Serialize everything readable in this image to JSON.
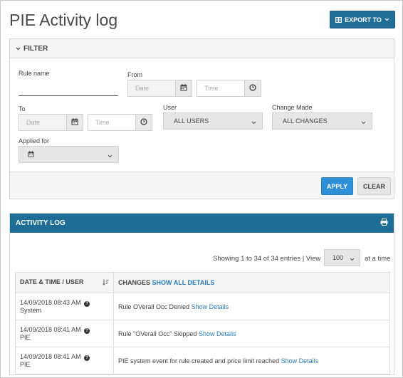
{
  "page": {
    "title": "PIE Activity log"
  },
  "export": {
    "label": "EXPORT TO",
    "icon": "table-icon"
  },
  "filter": {
    "header": "FILTER",
    "rule_name": {
      "label": "Rule name",
      "value": ""
    },
    "from": {
      "label": "From",
      "date_placeholder": "Date",
      "time_placeholder": "Time"
    },
    "to": {
      "label": "To",
      "date_placeholder": "Date",
      "time_placeholder": "Time"
    },
    "user": {
      "label": "User",
      "selected": "ALL USERS"
    },
    "change_made": {
      "label": "Change Made",
      "selected": "ALL CHANGES"
    },
    "applied_for": {
      "label": "Applied for",
      "selected": ""
    },
    "apply_label": "APPLY",
    "clear_label": "CLEAR"
  },
  "activity_log": {
    "header": "ACTIVITY LOG",
    "showing_text": "Showing 1 to 34 of 34 entries | View",
    "page_size": "100",
    "at_a_time": "at a time",
    "columns": {
      "datetime_user": "DATE & TIME / USER",
      "changes": "CHANGES",
      "show_all": "SHOW ALL DETAILS"
    },
    "rows": [
      {
        "datetime": "14/09/2018 08:43 AM",
        "user": "System",
        "change": "Rule OVerall Occ Denied",
        "link": "Show Details"
      },
      {
        "datetime": "14/09/2018 08:41 AM",
        "user": "PIE",
        "change": "Rule \"OVerall Occ\" Skipped",
        "link": "Show Details"
      },
      {
        "datetime": "14/09/2018 08:41 AM",
        "user": "PIE",
        "change": "PIE system event for rule created and price limit reached",
        "link": "Show Details"
      }
    ]
  },
  "colors": {
    "primary": "#1f6f99",
    "apply": "#2e8fd6",
    "link": "#2a7ab8"
  }
}
